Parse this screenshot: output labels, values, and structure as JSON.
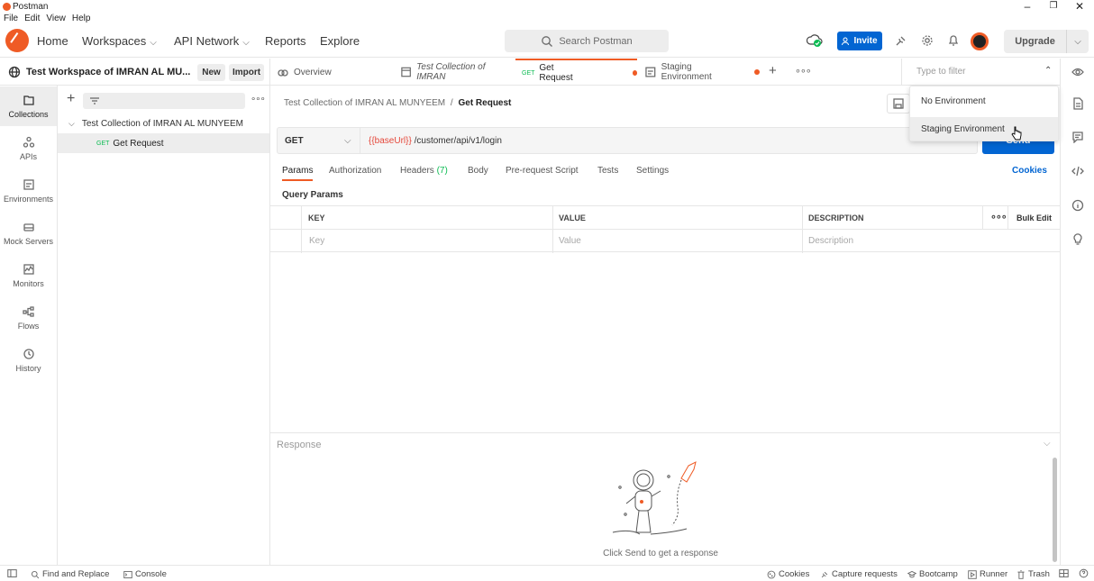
{
  "window": {
    "title": "Postman",
    "menu": [
      "File",
      "Edit",
      "View",
      "Help"
    ]
  },
  "header": {
    "home": "Home",
    "workspaces": "Workspaces",
    "api_network": "API Network",
    "reports": "Reports",
    "explore": "Explore",
    "search_placeholder": "Search Postman",
    "invite": "Invite",
    "upgrade": "Upgrade"
  },
  "workspace": {
    "name": "Test Workspace of IMRAN AL MU...",
    "new_label": "New",
    "import_label": "Import"
  },
  "tabs": [
    {
      "label": "Overview"
    },
    {
      "label": "Test Collection of IMRAN"
    },
    {
      "method": "GET",
      "label": "Get Request"
    },
    {
      "label": "Staging Environment"
    }
  ],
  "env_filter": {
    "placeholder": "Type to filter",
    "options": [
      "No Environment",
      "Staging Environment"
    ]
  },
  "sidebar": {
    "items": [
      {
        "label": "Collections"
      },
      {
        "label": "APIs"
      },
      {
        "label": "Environments"
      },
      {
        "label": "Mock Servers"
      },
      {
        "label": "Monitors"
      },
      {
        "label": "Flows"
      },
      {
        "label": "History"
      }
    ]
  },
  "collections": {
    "collection_name": "Test Collection of IMRAN AL MUNYEEM",
    "request_method": "GET",
    "request_name": "Get Request"
  },
  "request": {
    "breadcrumb_collection": "Test Collection of IMRAN AL MUNYEEM",
    "breadcrumb_sep": "/",
    "breadcrumb_request": "Get Request",
    "method": "GET",
    "url_variable": "{{baseUrl}}",
    "url_path": "/customer/api/v1/login",
    "send": "Send",
    "tabs": [
      "Params",
      "Authorization",
      "Headers",
      "Body",
      "Pre-request Script",
      "Tests",
      "Settings"
    ],
    "headers_count": "(7)",
    "cookies": "Cookies",
    "query_params_title": "Query Params",
    "columns": [
      "KEY",
      "VALUE",
      "DESCRIPTION"
    ],
    "bulk_edit": "Bulk Edit",
    "placeholders": [
      "Key",
      "Value",
      "Description"
    ]
  },
  "response": {
    "label": "Response",
    "hint": "Click Send to get a response"
  },
  "statusbar": {
    "find_replace": "Find and Replace",
    "console": "Console",
    "cookies": "Cookies",
    "capture": "Capture requests",
    "bootcamp": "Bootcamp",
    "runner": "Runner",
    "trash": "Trash"
  },
  "colors": {
    "accent": "#ef5b25",
    "primary": "#0265d2",
    "get": "#0cbb52",
    "variable": "#e5483b"
  }
}
